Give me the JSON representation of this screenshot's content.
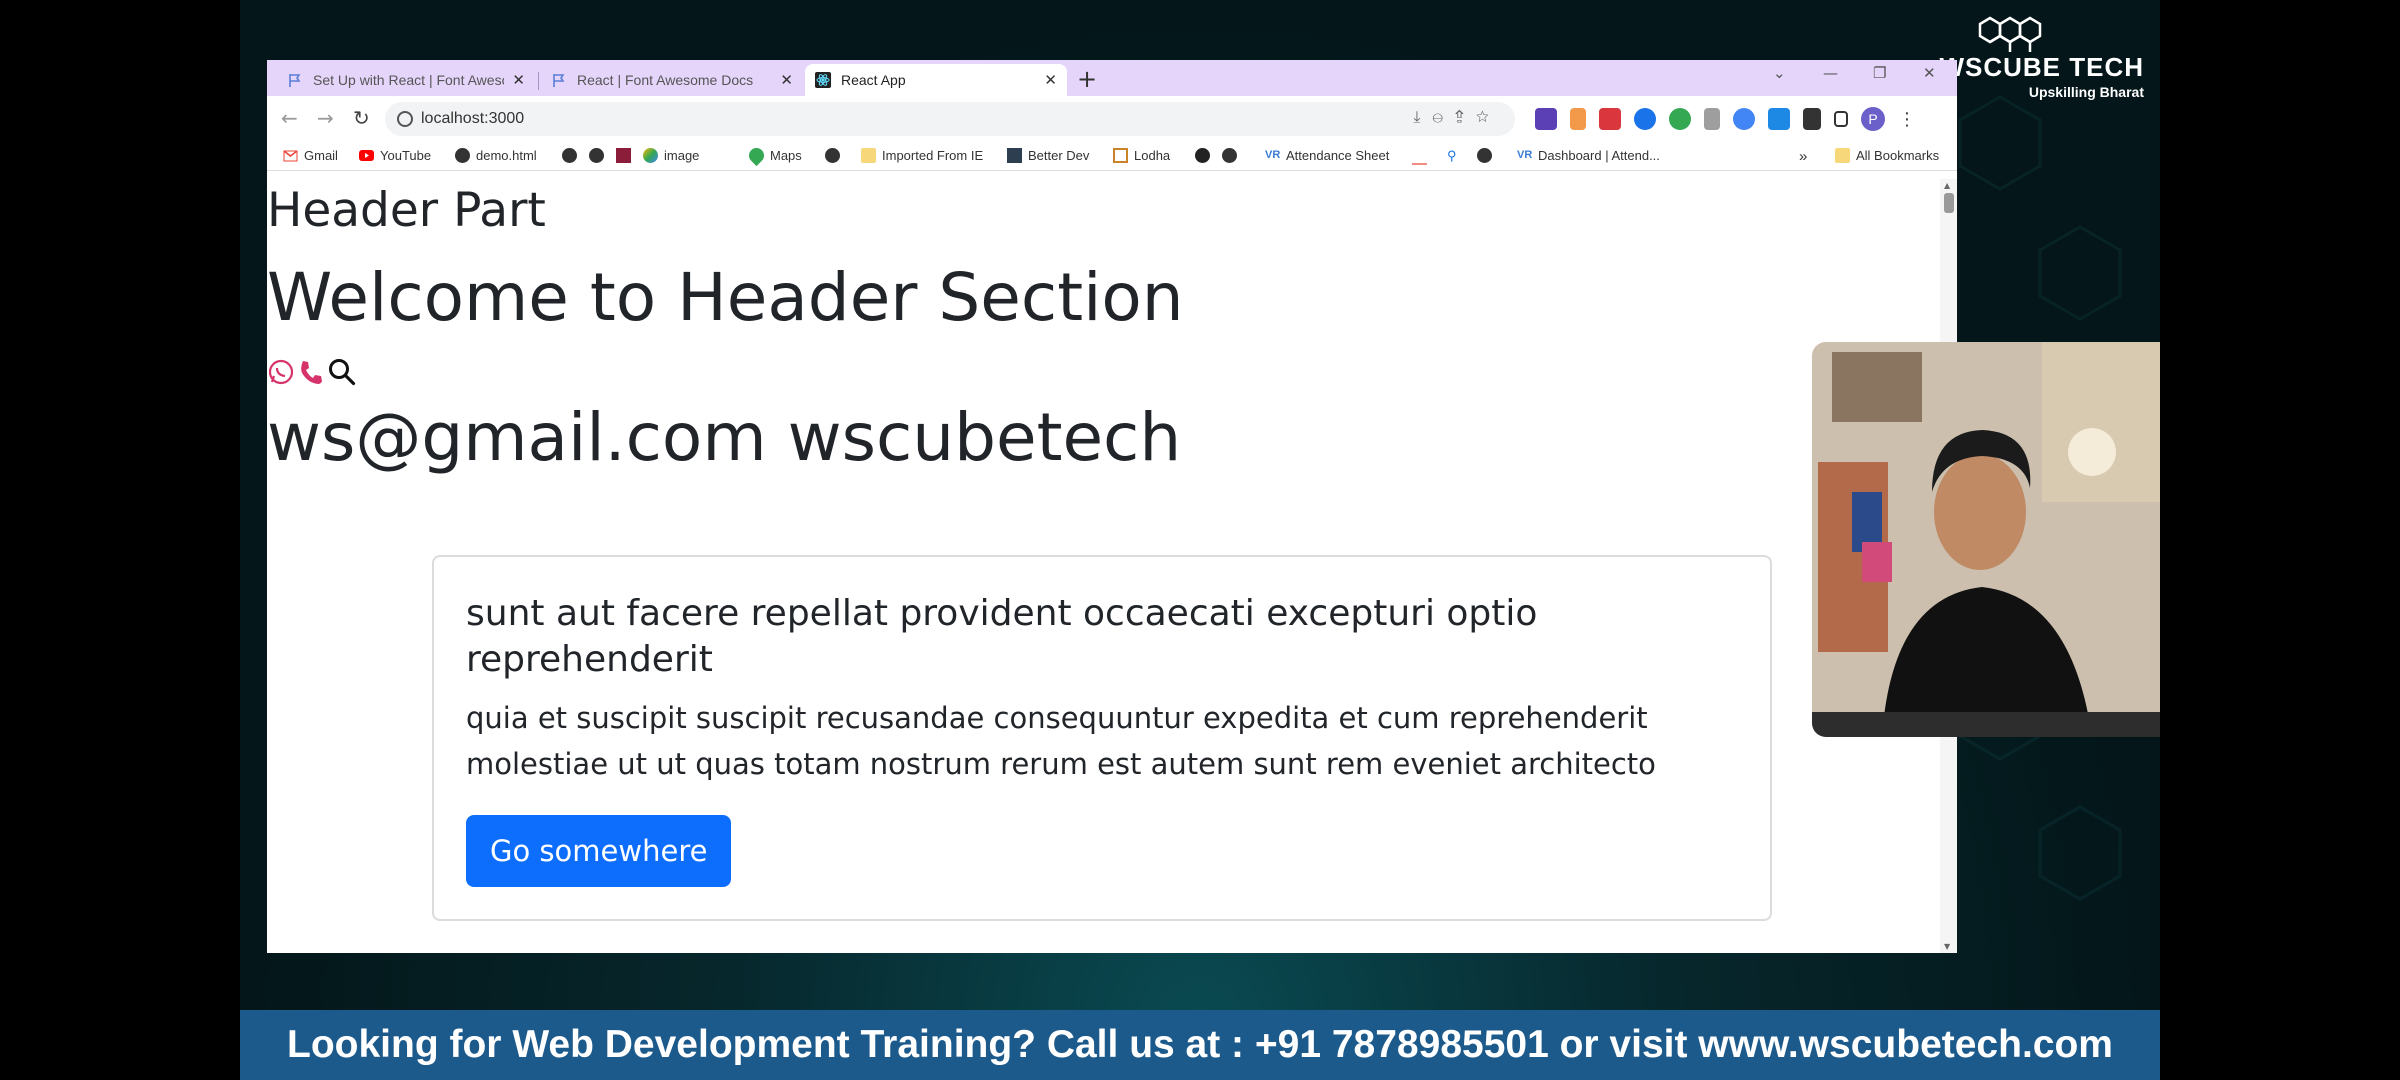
{
  "browser": {
    "tabs": [
      {
        "title": "Set Up with React | Font Awesome",
        "close": "✕"
      },
      {
        "title": "React | Font Awesome Docs",
        "close": "✕"
      },
      {
        "title": "React App",
        "close": "✕"
      }
    ],
    "new_tab": "+",
    "url": "localhost:3000",
    "profile_initial": "P",
    "bookmarks": [
      "Gmail",
      "YouTube",
      "demo.html",
      "image",
      "Maps",
      "Imported From IE",
      "Better Dev",
      "Lodha",
      "Attendance Sheet",
      "Dashboard | Attend..."
    ],
    "more_bookmarks": "»",
    "all_bookmarks": "All Bookmarks"
  },
  "page": {
    "header_small": "Header Part",
    "header_big": "Welcome to Header Section",
    "contact_line": "ws@gmail.com wscubetech",
    "card": {
      "title": "sunt aut facere repellat provident occaecati excepturi optio reprehenderit",
      "text": "quia et suscipit suscipit recusandae consequuntur expedita et cum reprehenderit molestiae ut ut quas totam nostrum rerum est autem sunt rem eveniet architecto",
      "button": "Go somewhere"
    }
  },
  "overlay": {
    "brand_name": "WSCUBE TECH",
    "brand_tagline": "Upskilling Bharat",
    "banner": "Looking for Web Development Training? Call us at : +91 7878985501 or visit www.wscubetech.com"
  },
  "colors": {
    "tabstrip": "#e6d5fb",
    "primary_button": "#0d6efd",
    "banner": "#1d5a8c",
    "phone_icon": "#d6336c"
  }
}
